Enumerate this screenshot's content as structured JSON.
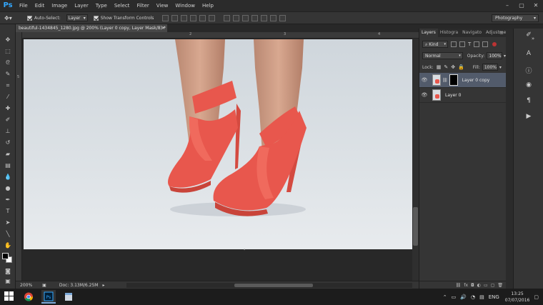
{
  "menubar": {
    "logo": "Ps",
    "items": [
      "File",
      "Edit",
      "Image",
      "Layer",
      "Type",
      "Select",
      "Filter",
      "View",
      "Window",
      "Help"
    ]
  },
  "options": {
    "auto_select_label": "Auto-Select:",
    "auto_select_value": "Layer",
    "show_transform_label": "Show Transform Controls",
    "workspace": "Photography"
  },
  "document": {
    "tab_title": "beautiful-1434845_1280.jpg @ 200% (Layer 0 copy, Layer Mask/8) *",
    "zoom": "200%",
    "doc_size": "Doc: 3.13M/6.25M",
    "ruler_top": [
      "2",
      "3",
      "4",
      "5"
    ],
    "ruler_left": [
      "5"
    ]
  },
  "layers_panel": {
    "tabs": [
      "Layers",
      "Histogra",
      "Navigato",
      "Adjustme"
    ],
    "filter_kind": "Kind",
    "blend_mode": "Normal",
    "opacity_label": "Opacity:",
    "opacity_value": "100%",
    "lock_label": "Lock:",
    "fill_label": "Fill:",
    "fill_value": "100%",
    "layers": [
      {
        "name": "Layer 0 copy",
        "selected": true,
        "has_mask": true
      },
      {
        "name": "Layer 0",
        "selected": false,
        "has_mask": false
      }
    ]
  },
  "taskbar": {
    "language": "ENG",
    "time": "13:25",
    "date": "07/07/2016"
  },
  "colors": {
    "accent": "#33a8ff",
    "shoe": "#e8574d",
    "selected_layer": "#525b6b"
  }
}
